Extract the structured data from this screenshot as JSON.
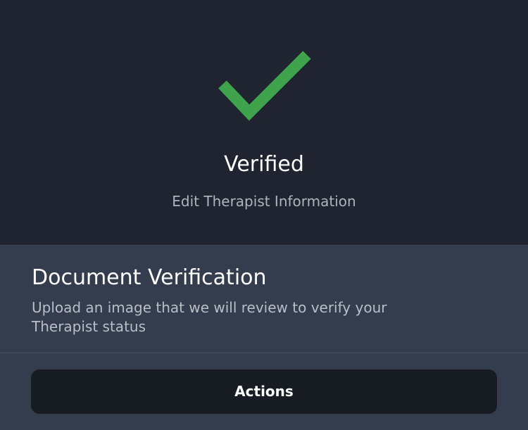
{
  "status": {
    "icon": "checkmark-icon",
    "icon_color": "#3fa34d",
    "title": "Verified",
    "link": "Edit Therapist Information"
  },
  "document_section": {
    "title": "Document Verification",
    "description": "Upload an image that we will review to verify your Therapist status"
  },
  "actions": {
    "label": "Actions"
  },
  "colors": {
    "top_background": "#1f2430",
    "panel_background": "#333d4d",
    "button_background": "#171b22"
  }
}
